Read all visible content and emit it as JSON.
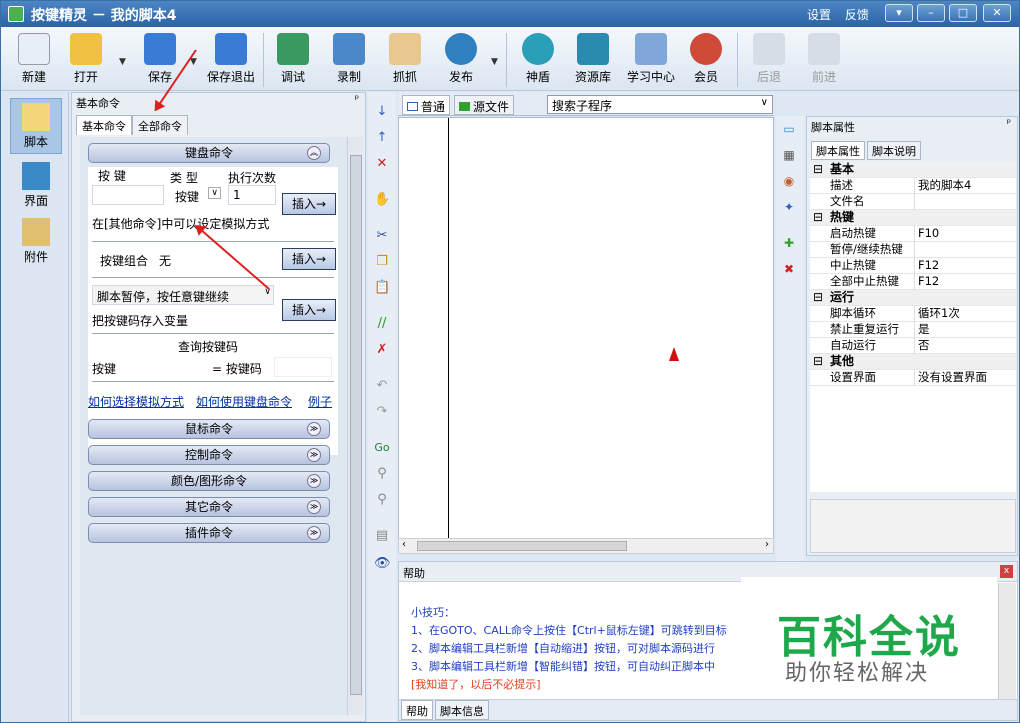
{
  "window": {
    "title": "按键精灵 － 我的脚本4",
    "links": [
      "设置",
      "反馈"
    ],
    "controls": [
      "▾",
      "–",
      "□",
      "✕"
    ]
  },
  "toolbar": {
    "items": [
      {
        "label": "新建",
        "icon": "new-file-icon"
      },
      {
        "label": "打开",
        "icon": "open-folder-icon"
      },
      {
        "label": "保存",
        "icon": "save-icon"
      },
      {
        "label": "保存退出",
        "icon": "save-exit-icon"
      },
      {
        "label": "调试",
        "icon": "debug-icon"
      },
      {
        "label": "录制",
        "icon": "record-camera-icon"
      },
      {
        "label": "抓抓",
        "icon": "grab-hand-icon"
      },
      {
        "label": "发布",
        "icon": "publish-globe-icon"
      },
      {
        "label": "神盾",
        "icon": "shield-icon"
      },
      {
        "label": "资源库",
        "icon": "resource-library-icon"
      },
      {
        "label": "学习中心",
        "icon": "learning-center-icon"
      },
      {
        "label": "会员",
        "icon": "member-icon"
      },
      {
        "label": "后退",
        "icon": "back-arrow-icon"
      },
      {
        "label": "前进",
        "icon": "forward-arrow-icon"
      }
    ]
  },
  "leftnav": {
    "items": [
      "脚本",
      "界面",
      "附件"
    ]
  },
  "cmdpanel": {
    "title": "基本命令",
    "pin": "ᵖ",
    "tabs": [
      "基本命令",
      "全部命令"
    ],
    "keyboard": {
      "header": "键盘命令",
      "col_key": "按 键",
      "col_type": "类 型",
      "col_count": "执行次数",
      "type_value": "按键",
      "count_value": "1",
      "insert_label": "插入→",
      "hint": "在[其他命令]中可以设定模拟方式",
      "combo_label": "按键组合",
      "combo_value": "无",
      "pause_value": "脚本暂停，按任意键继续",
      "store_label": "把按键码存入变量",
      "query_title": "查询按键码",
      "query_key": "按键",
      "query_code": "= 按键码",
      "links": [
        "如何选择模拟方式",
        "如何使用键盘命令",
        "例子"
      ]
    },
    "groups": [
      "鼠标命令",
      "控制命令",
      "颜色/图形命令",
      "其它命令",
      "插件命令"
    ],
    "chev": "≫"
  },
  "editor": {
    "tabs": [
      "普通",
      "源文件"
    ],
    "search_value": "搜索子程序"
  },
  "props": {
    "title": "脚本属性",
    "tabs": [
      "脚本属性",
      "脚本说明"
    ],
    "rows": [
      {
        "cat": true,
        "k": "基本"
      },
      {
        "k": "描述",
        "v": "我的脚本4"
      },
      {
        "k": "文件名",
        "v": ""
      },
      {
        "cat": true,
        "k": "热键"
      },
      {
        "k": "启动热键",
        "v": "F10"
      },
      {
        "k": "暂停/继续热键",
        "v": ""
      },
      {
        "k": "中止热键",
        "v": "F12"
      },
      {
        "k": "全部中止热键",
        "v": "F12"
      },
      {
        "cat": true,
        "k": "运行"
      },
      {
        "k": "脚本循环",
        "v": "循环1次"
      },
      {
        "k": "禁止重复运行",
        "v": "是"
      },
      {
        "k": "自动运行",
        "v": "否"
      },
      {
        "cat": true,
        "k": "其他"
      },
      {
        "k": "设置界面",
        "v": "没有设置界面"
      }
    ]
  },
  "help": {
    "title": "帮助",
    "lines": [
      "小技巧：",
      "1、在GOTO、CALL命令上按住【Ctrl+鼠标左键】可跳转到目标",
      "2、脚本编辑工具栏新增【自动缩进】按钮，可对脚本源码进行",
      "3、脚本编辑工具栏新增【智能纠错】按钮，可自动纠正脚本中",
      "[我知道了，以后不必提示]"
    ],
    "tabs": [
      "帮助",
      "脚本信息"
    ]
  },
  "watermark": {
    "big": "百科全说",
    "small": "助你轻松解决"
  }
}
